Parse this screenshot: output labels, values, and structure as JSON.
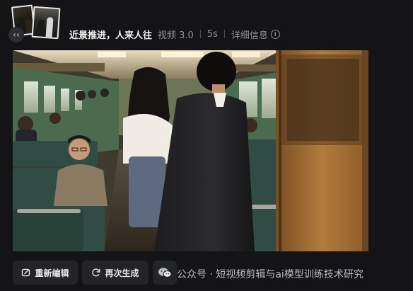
{
  "header": {
    "title": "近景推进，人来人往",
    "type": "视频 3.0",
    "duration": "5s",
    "details": "详细信息",
    "avatar_glyph": "‹‹"
  },
  "icons": {
    "info": "info-icon",
    "edit": "edit-icon",
    "regenerate": "refresh-icon",
    "more": "wechat-icon"
  },
  "actions": {
    "edit_label": "重新编辑",
    "regenerate_label": "再次生成"
  },
  "watermark": {
    "text": "公众号 · 短视频剪辑与ai模型训练技术研究"
  },
  "colors": {
    "background": "#141416",
    "button": "#232428",
    "seat_green": "#2f4d44",
    "door_wood": "#b07a3a"
  }
}
